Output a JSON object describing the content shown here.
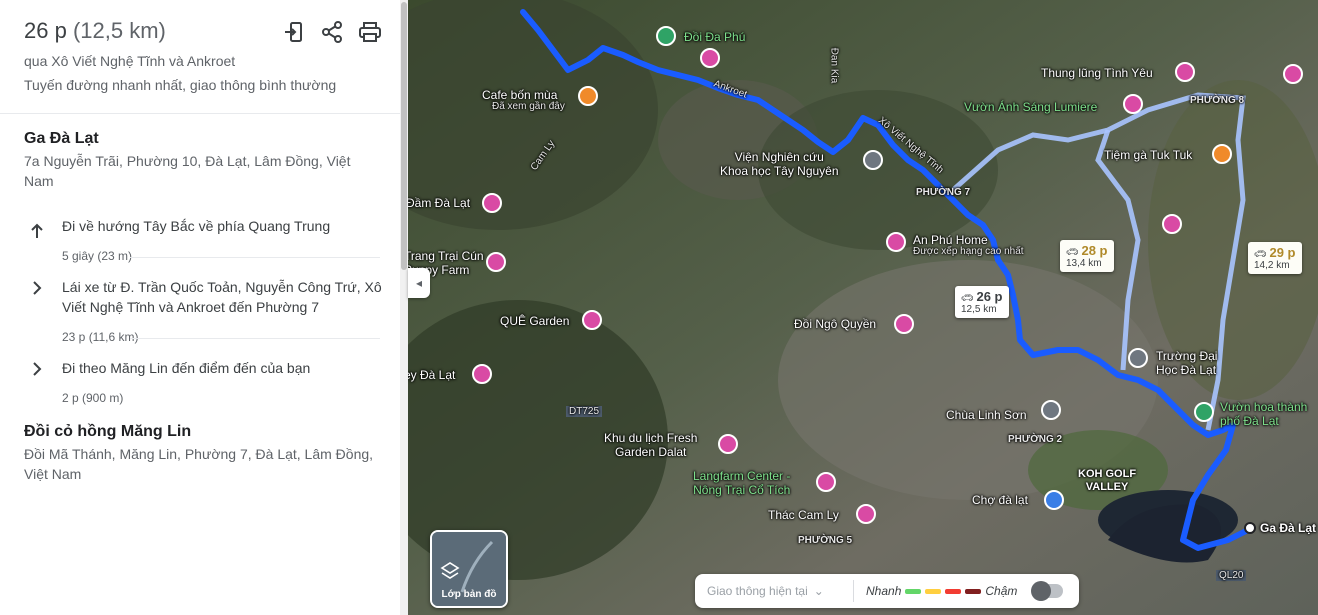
{
  "summary": {
    "duration": "26 p",
    "distance": "(12,5 km)",
    "via": "qua Xô Viết Nghệ Tĩnh và Ankroet",
    "note": "Tuyến đường nhanh nhất, giao thông bình thường"
  },
  "origin": {
    "name": "Ga Đà Lạt",
    "address": "7a Nguyễn Trãi, Phường 10, Đà Lạt, Lâm Đồng, Việt Nam"
  },
  "steps": [
    {
      "icon": "arrow-up-icon",
      "text": "Đi về hướng Tây Bắc về phía Quang Trung",
      "meta": "5 giây (23 m)"
    },
    {
      "icon": "chevron-right-icon",
      "text": "Lái xe từ Đ. Trần Quốc Toản, Nguyễn Công Trứ, Xô Viết Nghệ Tĩnh và Ankroet đến Phường 7",
      "meta": "23 p (11,6 km)"
    },
    {
      "icon": "chevron-right-icon",
      "text": "Đi theo Măng Lin đến điểm đến của bạn",
      "meta": "2 p (900 m)"
    }
  ],
  "destination": {
    "name": "Đồi cỏ hồng Măng Lin",
    "address": "Đồi Mã Thánh, Măng Lin, Phường 7, Đà Lạt, Lâm Đồng, Việt Nam"
  },
  "map": {
    "labels": {
      "doi_da_phu": "Đồi Đa Phú",
      "cafe_bon_mua": "Cafe bốn mùa",
      "cafe_sub": "Đã xem gần đây",
      "ankroet": "Ankroet",
      "dan_kia": "Đan Kia",
      "thung_lung": "Thung lũng Tình Yêu",
      "vuon_anh_sang": "Vườn Ánh Sáng Lumiere",
      "phuong8": "PHƯỜNG 8",
      "vien_nghien_cuu": "Viện Nghiên cứu\nKhoa học Tây Nguyên",
      "xo_viet": "Xô Viết Nghệ Tĩnh",
      "tiem_ga": "Tiệm gà Tuk Tuk",
      "phuong7": "PHƯỜNG 7",
      "dam_da_lat": "Đầm Đà Lạt",
      "an_phu": "An Phú Home",
      "an_phu_sub": "Được xếp hạng cao nhất",
      "trang_trai": "Trang Trại Cún\nPuppy Farm",
      "que_garden": "QUÊ Garden",
      "doi_ngo_quyen": "Đồi Ngô Quyền",
      "truong_dai_hoc": "Trường Đại\nHọc Đà Lạt",
      "valley": "ey Đà Lạt",
      "dt725": "DT725",
      "chua_linh_son": "Chùa Linh Sơn",
      "vuon_hoa": "Vườn hoa thành\nphố Đà Lạt",
      "phuong2": "PHƯỜNG 2",
      "khu_du_lich": "Khu du lịch Fresh\nGarden Dalat",
      "koh_golf": "KOH GOLF\nVALLEY",
      "langfarm": "Langfarm Center -\nNông Trại Cổ Tích",
      "cho_da_lat": "Chợ đà lạt",
      "thac_cam_ly": "Thác Cam Ly",
      "phuong5": "PHƯỜNG 5",
      "ga_da_lat": "Ga Đà Lạt",
      "ql20": "QL20",
      "cam_ly": "Cam Ly"
    },
    "route_main": {
      "time": "26 p",
      "distance": "12,5 km"
    },
    "route_alt1": {
      "time": "28 p",
      "distance": "13,4 km"
    },
    "route_alt2": {
      "time": "29 p",
      "distance": "14,2 km"
    },
    "layers_label": "Lớp bản đồ",
    "traffic": {
      "select": "Giao thông hiện tại",
      "fast": "Nhanh",
      "slow": "Chậm",
      "colors": [
        "#63d668",
        "#ffcf3f",
        "#f23c32",
        "#811f1f"
      ]
    },
    "route_color": "#1a5cff",
    "alt_route_color": "#a9c4ff"
  }
}
